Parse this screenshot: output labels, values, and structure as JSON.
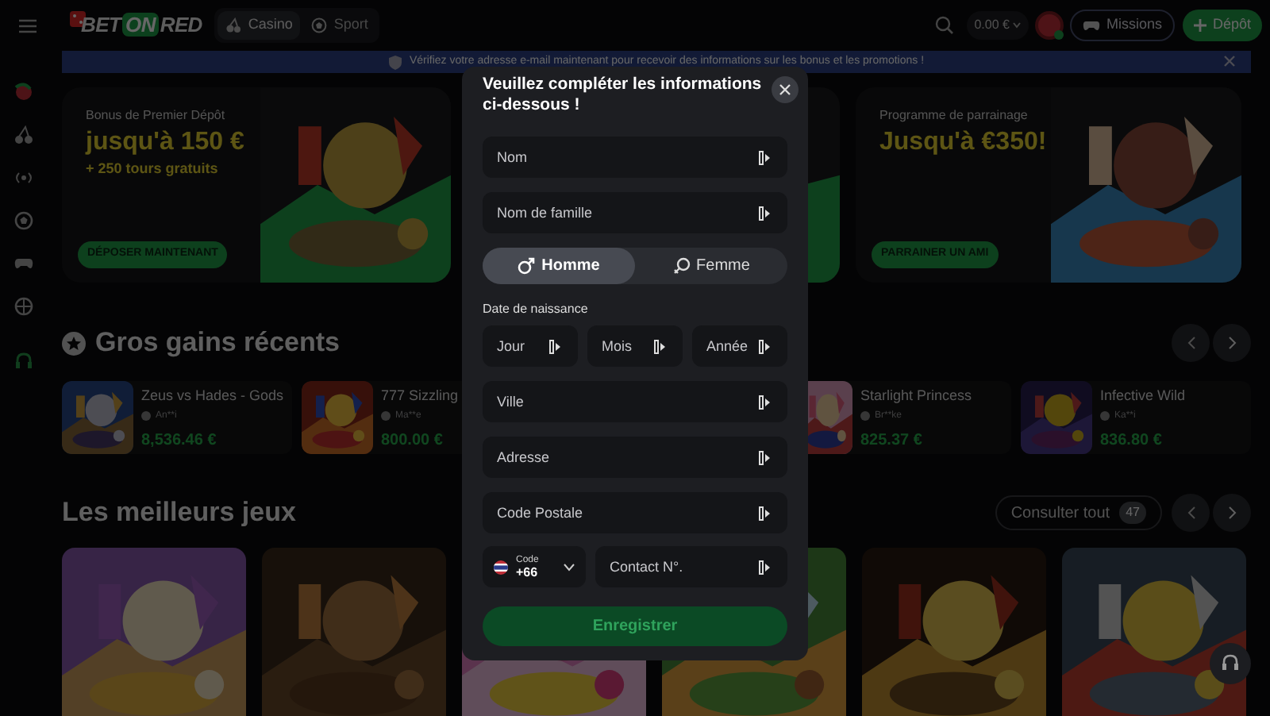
{
  "header": {
    "logo": [
      "BET",
      "ON",
      "RED"
    ],
    "nav_tabs": [
      {
        "label": "Casino",
        "selected": true
      },
      {
        "label": "Sport",
        "selected": false
      }
    ],
    "balance": "0.00 €",
    "missions": "Missions",
    "deposit": "Dépôt"
  },
  "notice": {
    "text": "Vérifiez votre adresse e-mail maintenant pour recevoir des informations sur les bonus et les promotions !"
  },
  "banners": [
    {
      "subtitle": "Bonus de Premier Dépôt",
      "headline": "jusqu'à 150 €",
      "detail": "+ 250 tours gratuits",
      "button": "DÉPOSER MAINTENANT"
    },
    {
      "kind": "picture"
    },
    {
      "subtitle": "Programme de parrainage",
      "headline": "Jusqu'à €350!",
      "button": "PARRAINER UN AMI"
    }
  ],
  "recent_wins": {
    "title": "Gros gains récents",
    "items": [
      {
        "game": "Zeus vs Hades - Gods",
        "player": "An**i",
        "amount": "8,536.46 €"
      },
      {
        "game": "777 Sizzling",
        "player": "Ma**e",
        "amount": "800.00 €"
      },
      {
        "game": "Starlight Princess",
        "player": "Br**ke",
        "amount": "825.37 €"
      },
      {
        "game": "Infective Wild",
        "player": "Ka**i",
        "amount": "836.80 €"
      }
    ]
  },
  "top_games": {
    "title": "Les meilleurs jeux",
    "view_all": "Consulter tout",
    "count": "47",
    "tiles": [
      {
        "kind": "picture"
      },
      {
        "kind": "picture"
      },
      {
        "kind": "picture"
      },
      {
        "kind": "picture"
      },
      {
        "kind": "picture"
      },
      {
        "kind": "picture"
      }
    ]
  },
  "modal": {
    "title": "Veuillez compléter les informations ci-dessous !",
    "name_fields": [
      {
        "placeholder": "Nom"
      },
      {
        "placeholder": "Nom de famille"
      }
    ],
    "gender": [
      {
        "label": "Homme",
        "selected": true
      },
      {
        "label": "Femme",
        "selected": false
      }
    ],
    "birth_label": "Date de naissance",
    "birth_fields": [
      {
        "placeholder": "Jour"
      },
      {
        "placeholder": "Mois"
      },
      {
        "placeholder": "Année"
      }
    ],
    "address_fields": [
      {
        "placeholder": "Ville"
      },
      {
        "placeholder": "Adresse"
      },
      {
        "placeholder": "Code Postale"
      }
    ],
    "phone": {
      "code_label": "Code",
      "code": "+66",
      "placeholder": "Contact N°."
    },
    "submit": {
      "label": "Enregistrer",
      "disabled": true
    }
  }
}
